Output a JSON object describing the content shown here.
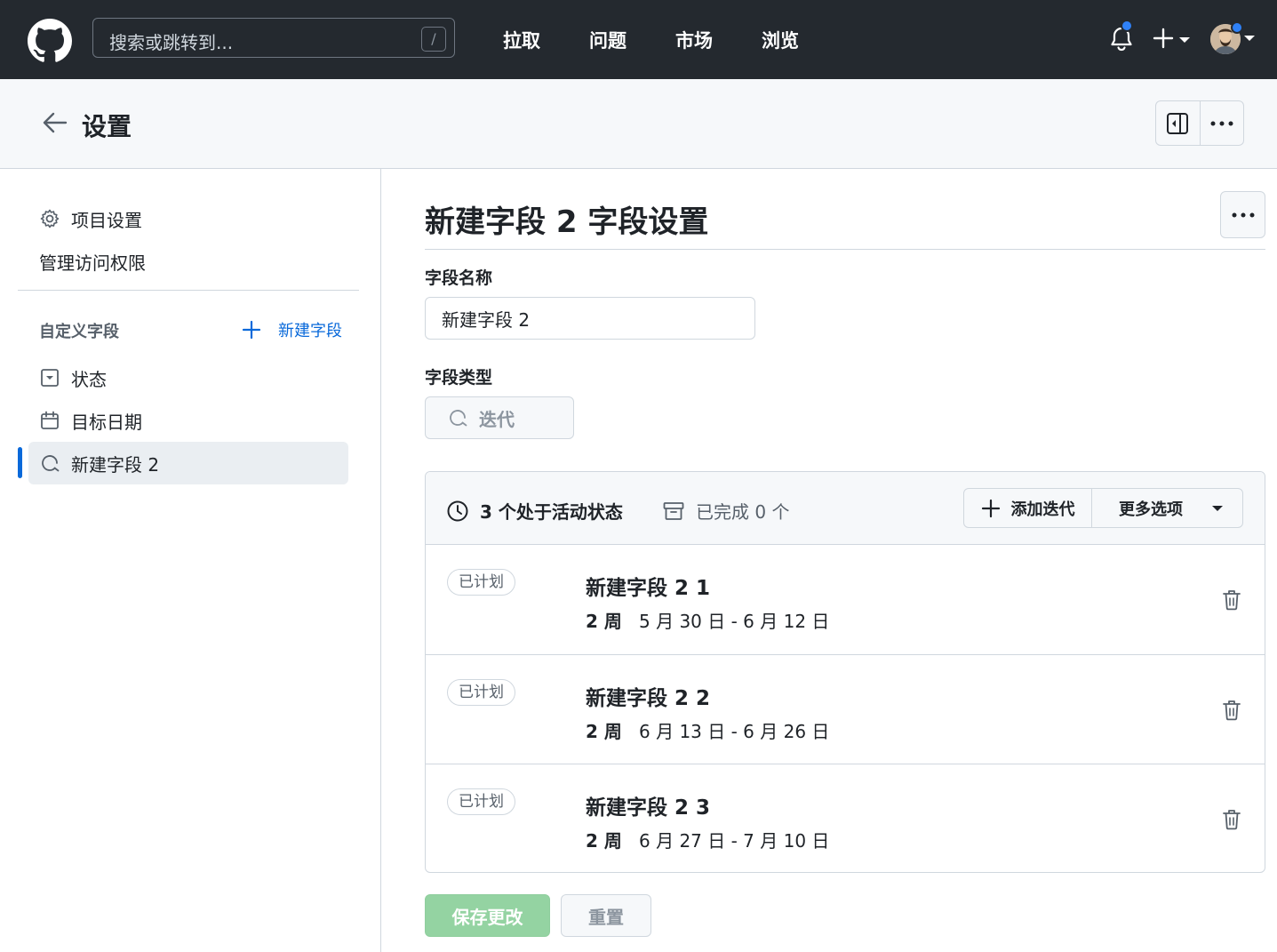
{
  "topnav": {
    "search_placeholder": "搜索或跳转到...",
    "search_shortcut": "/",
    "links": [
      "拉取",
      "问题",
      "市场",
      "浏览"
    ]
  },
  "header": {
    "title": "设置"
  },
  "sidebar": {
    "items": [
      {
        "label": "项目设置",
        "icon": "gear-icon"
      },
      {
        "label": "管理访问权限",
        "icon": ""
      }
    ],
    "section_label": "自定义字段",
    "new_field_label": "新建字段",
    "fields": [
      {
        "label": "状态",
        "icon": "single-select-icon"
      },
      {
        "label": "目标日期",
        "icon": "calendar-icon"
      },
      {
        "label": "新建字段 2",
        "icon": "iteration-icon",
        "active": true
      }
    ]
  },
  "main": {
    "title": "新建字段 2 字段设置",
    "field_name_label": "字段名称",
    "field_name_value": "新建字段 2",
    "field_type_label": "字段类型",
    "field_type_value": "迭代",
    "panel": {
      "active_text": "3 个处于活动状态",
      "completed_text": "已完成 0 个",
      "add_iteration_label": "添加迭代",
      "more_options_label": "更多选项"
    },
    "iterations": [
      {
        "badge": "已计划",
        "name": "新建字段 2 1",
        "duration": "2 周",
        "dates": "5 月 30 日 - 6 月 12 日"
      },
      {
        "badge": "已计划",
        "name": "新建字段 2 2",
        "duration": "2 周",
        "dates": "6 月 13 日 - 6 月 26 日"
      },
      {
        "badge": "已计划",
        "name": "新建字段 2 3",
        "duration": "2 周",
        "dates": "6 月 27 日 - 7 月 10 日"
      }
    ],
    "save_label": "保存更改",
    "reset_label": "重置"
  },
  "colors": {
    "topbar": "#24292f",
    "accent": "#0969da",
    "save_disabled": "#94d3a2",
    "notification_dot": "#2f81f7"
  }
}
